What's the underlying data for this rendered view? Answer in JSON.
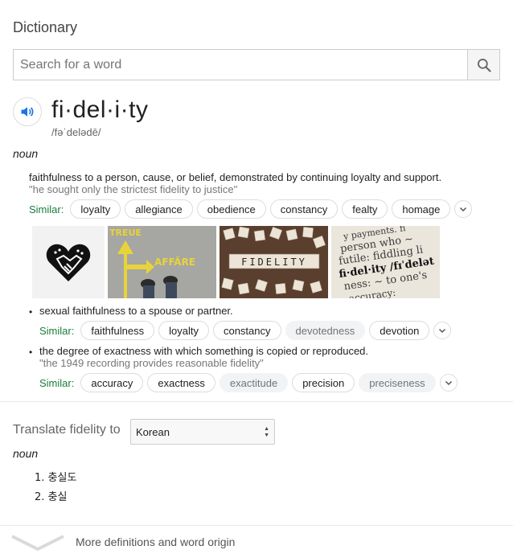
{
  "panel": {
    "title": "Dictionary"
  },
  "search": {
    "placeholder": "Search for a word",
    "value": ""
  },
  "entry": {
    "word": "fi·del·i·ty",
    "phonetic": "/fəˈdelədē/",
    "part_of_speech": "noun",
    "senses": [
      {
        "definition": "faithfulness to a person, cause, or belief, demonstrated by continuing loyalty and support.",
        "example": "\"he sought only the strictest fidelity to justice\"",
        "similar_label": "Similar:",
        "similar": [
          "loyalty",
          "allegiance",
          "obedience",
          "constancy",
          "fealty",
          "homage"
        ],
        "images": [
          {
            "icon": "handshake-heart"
          },
          {
            "icon": "arrow-street",
            "text_top": "TREUE",
            "text_right": "AFFÄRE"
          },
          {
            "icon": "letter-tiles",
            "text": "FIDELITY"
          },
          {
            "icon": "dictionary-page",
            "lines": [
              "y payments. fi",
              "person who ~",
              "futile: fiddling li",
              "fi·del·ity /fɪˈdelət",
              "ness: ~ to one's",
              "accuracy:"
            ]
          }
        ]
      },
      {
        "bullet": "•",
        "definition": "sexual faithfulness to a spouse or partner.",
        "similar_label": "Similar:",
        "similar": [
          "faithfulness",
          "loyalty",
          "constancy",
          "devotedness",
          "devotion"
        ],
        "muted": [
          "devotedness"
        ]
      },
      {
        "bullet": "•",
        "definition": "the degree of exactness with which something is copied or reproduced.",
        "example": "\"the 1949 recording provides reasonable fidelity\"",
        "similar_label": "Similar:",
        "similar": [
          "accuracy",
          "exactness",
          "exactitude",
          "precision",
          "preciseness"
        ],
        "muted": [
          "exactitude",
          "preciseness"
        ]
      }
    ]
  },
  "translate": {
    "label": "Translate fidelity to",
    "language": "Korean",
    "part_of_speech": "noun",
    "items": [
      "1. 충실도",
      "2. 충실"
    ]
  },
  "footer": {
    "more_label": "More definitions and word origin"
  },
  "colors": {
    "similar_green": "#1a7d3b",
    "speaker_blue": "#1a73e8"
  }
}
